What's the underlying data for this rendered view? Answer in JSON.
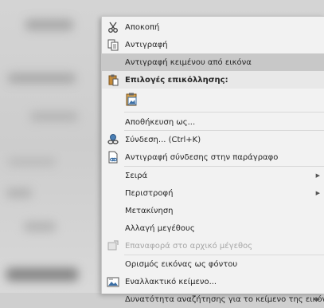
{
  "menu": {
    "items": [
      {
        "label": "Αποκοπή",
        "icon": "scissors-icon"
      },
      {
        "label": "Αντιγραφή",
        "icon": "copy-icon"
      },
      {
        "label": "Αντιγραφή κειμένου από εικόνα",
        "icon": ""
      },
      {
        "label": "Επιλογές επικόλλησης:",
        "icon": "clipboard-icon"
      },
      {
        "label": "",
        "icon": "paste-picture-icon"
      },
      {
        "label": "Αποθήκευση ως...",
        "icon": ""
      },
      {
        "label": "Σύνδεση...  (Ctrl+K)",
        "icon": "link-icon"
      },
      {
        "label": "Αντιγραφή σύνδεσης στην παράγραφο",
        "icon": "copy-link-icon"
      },
      {
        "label": "Σειρά",
        "icon": ""
      },
      {
        "label": "Περιστροφή",
        "icon": ""
      },
      {
        "label": "Μετακίνηση",
        "icon": ""
      },
      {
        "label": "Αλλαγή μεγέθους",
        "icon": ""
      },
      {
        "label": "Επαναφορά στο αρχικό μέγεθος",
        "icon": "reset-size-icon"
      },
      {
        "label": "Ορισμός εικόνας ως φόντου",
        "icon": ""
      },
      {
        "label": "Εναλλακτικό κείμενο...",
        "icon": "alt-text-icon"
      },
      {
        "label": "Δυνατότητα αναζήτησης για το κείμενο της εικόνας",
        "icon": ""
      }
    ]
  }
}
